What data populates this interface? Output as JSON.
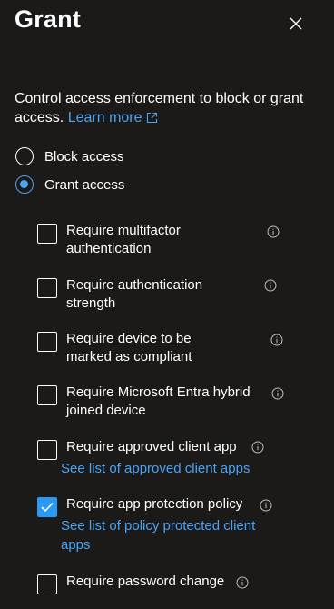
{
  "panel": {
    "title": "Grant",
    "description": "Control access enforcement to block or grant access.",
    "learn_more": "Learn more"
  },
  "access": {
    "block_label": "Block access",
    "grant_label": "Grant access",
    "selected": "grant"
  },
  "requirements": [
    {
      "label": "Require multifactor authentication",
      "checked": false
    },
    {
      "label": "Require authentication strength",
      "checked": false
    },
    {
      "label": "Require device to be marked as compliant",
      "checked": false
    },
    {
      "label": "Require Microsoft Entra hybrid joined device",
      "checked": false
    },
    {
      "label": "Require approved client app",
      "checked": false,
      "link": "See list of approved client apps"
    },
    {
      "label": "Require app protection policy",
      "checked": true,
      "link": "See list of policy protected client apps"
    },
    {
      "label": "Require password change",
      "checked": false
    }
  ],
  "colors": {
    "background": "#1b1a19",
    "link": "#4aa3f3",
    "checkbox_checked": "#2899f5"
  },
  "icons": {
    "close": "close-icon",
    "info": "info-icon",
    "external_link": "external-link-icon",
    "checkmark": "checkmark-icon"
  }
}
